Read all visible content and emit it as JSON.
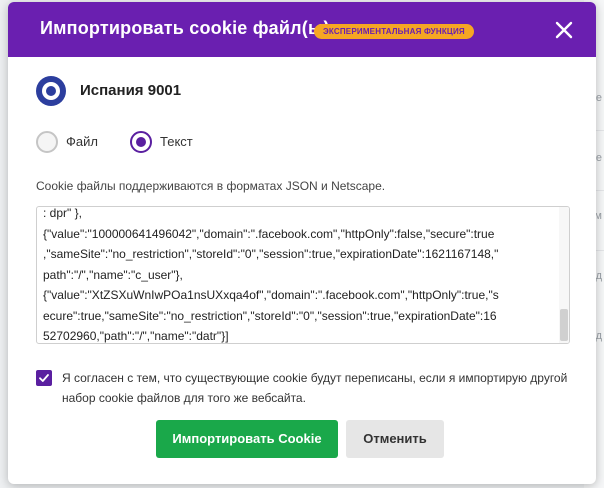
{
  "background": {
    "glyphs": [
      "ге",
      "ие",
      "ом",
      "д",
      "д"
    ]
  },
  "dialog": {
    "title": "Импортировать cookie файл(ы)",
    "badge": "ЭКСПЕРИМЕНТАЛЬНАЯ ФУНКЦИЯ",
    "close_icon": "close-icon",
    "colors": {
      "header": "#6a1fb0",
      "badge": "#f6a623",
      "accent": "#5a1fa0",
      "import_button": "#1aa84a"
    }
  },
  "profile": {
    "name": "Испания 9001",
    "icon": "profile-icon"
  },
  "source": {
    "options": [
      {
        "label": "Файл",
        "selected": false
      },
      {
        "label": "Текст",
        "selected": true
      }
    ]
  },
  "formats_note": "Cookie файлы поддерживаются в форматах JSON и Netscape.",
  "cookie_text": ": dpr\" },\n{\"value\":\"100000641496042\",\"domain\":\".facebook.com\",\"httpOnly\":false,\"secure\":true\n,\"sameSite\":\"no_restriction\",\"storeId\":\"0\",\"session\":true,\"expirationDate\":1621167148,\"\npath\":\"/\",\"name\":\"c_user\"},\n{\"value\":\"XtZSXuWnIwPOa1nsUXxqa4of\",\"domain\":\".facebook.com\",\"httpOnly\":true,\"s\necure\":true,\"sameSite\":\"no_restriction\",\"storeId\":\"0\",\"session\":true,\"expirationDate\":16\n52702960,\"path\":\"/\",\"name\":\"datr\"}]",
  "agreement": {
    "checked": true,
    "text": "Я согласен с тем, что существующие cookie будут переписаны, если я импортирую другой набор cookie файлов для того же вебсайта."
  },
  "buttons": {
    "import": "Импортировать Cookie",
    "cancel": "Отменить"
  }
}
